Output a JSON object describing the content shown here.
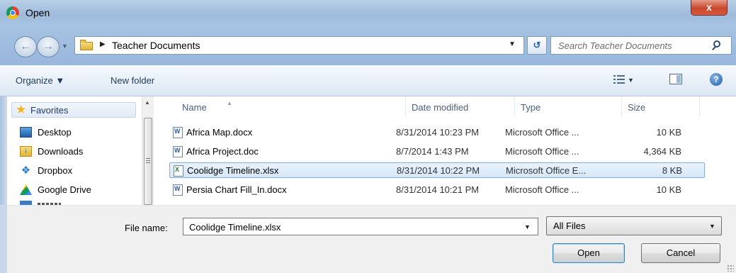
{
  "window": {
    "title": "Open",
    "close_label": "x"
  },
  "address": {
    "folder": "Teacher Documents"
  },
  "search": {
    "placeholder": "Search Teacher Documents"
  },
  "toolbar": {
    "organize_label": "Organize ▼",
    "new_folder_label": "New folder",
    "help_label": "?"
  },
  "navigation": {
    "favorites_label": "Favorites",
    "items": [
      {
        "label": "Desktop",
        "icon": "desktop-icon"
      },
      {
        "label": "Downloads",
        "icon": "downloads-folder-icon"
      },
      {
        "label": "Dropbox",
        "icon": "dropbox-icon"
      },
      {
        "label": "Google Drive",
        "icon": "google-drive-icon"
      }
    ]
  },
  "columns": {
    "name": "Name",
    "date": "Date modified",
    "type": "Type",
    "size": "Size"
  },
  "files": [
    {
      "name": "Africa Map.docx",
      "date": "8/31/2014 10:23 PM",
      "type": "Microsoft Office ...",
      "size": "10 KB",
      "icon": "word-document-icon",
      "selected": false
    },
    {
      "name": "Africa Project.doc",
      "date": "8/7/2014 1:43 PM",
      "type": "Microsoft Office ...",
      "size": "4,364 KB",
      "icon": "word-document-icon",
      "selected": false
    },
    {
      "name": "Coolidge Timeline.xlsx",
      "date": "8/31/2014 10:22 PM",
      "type": "Microsoft Office E...",
      "size": "8 KB",
      "icon": "excel-workbook-icon",
      "selected": true
    },
    {
      "name": "Persia Chart Fill_In.docx",
      "date": "8/31/2014 10:21 PM",
      "type": "Microsoft Office ...",
      "size": "10 KB",
      "icon": "word-document-icon",
      "selected": false
    }
  ],
  "footer": {
    "file_name_label": "File name:",
    "file_name_value": "Coolidge Timeline.xlsx",
    "file_type_value": "All Files",
    "open_label": "Open",
    "cancel_label": "Cancel"
  }
}
